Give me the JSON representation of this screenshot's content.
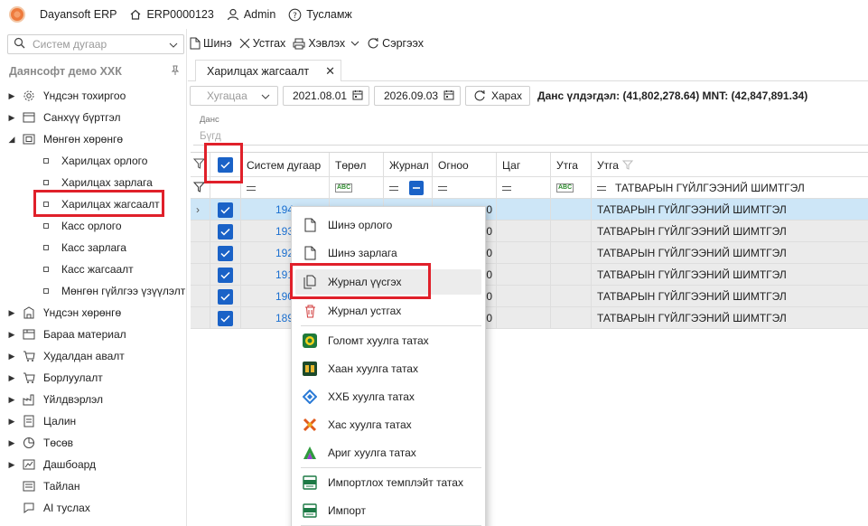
{
  "app": {
    "name": "Dayansoft ERP",
    "doc_code": "ERP0000123",
    "user": "Admin",
    "help": "Тусламж"
  },
  "sidebar": {
    "search_placeholder": "Систем дугаар",
    "company": "Даянсофт демо ХХК",
    "items": [
      {
        "label": "Үндсэн тохиргоо",
        "icon": "gear-icon",
        "expanded": false
      },
      {
        "label": "Санхүү бүртгэл",
        "icon": "ledger-icon",
        "expanded": false
      },
      {
        "label": "Мөнгөн хөрөнгө",
        "icon": "money-icon",
        "expanded": true
      }
    ],
    "subitems": [
      "Харилцах орлого",
      "Харилцах зарлага",
      "Харилцах жагсаалт",
      "Касс орлого",
      "Касс зарлага",
      "Касс жагсаалт",
      "Мөнгөн гүйлгээ үзүүлэлт"
    ],
    "active_subitem": "Харилцах жагсаалт",
    "items_after": [
      {
        "label": "Үндсэн хөрөнгө",
        "icon": "building-icon"
      },
      {
        "label": "Бараа материал",
        "icon": "box-icon"
      },
      {
        "label": "Худалдан авалт",
        "icon": "cart-icon"
      },
      {
        "label": "Борлуулалт",
        "icon": "sale-icon"
      },
      {
        "label": "Үйлдвэрлэл",
        "icon": "factory-icon"
      },
      {
        "label": "Цалин",
        "icon": "salary-icon"
      },
      {
        "label": "Төсөв",
        "icon": "pie-icon"
      },
      {
        "label": "Дашбоард",
        "icon": "dashboard-icon"
      },
      {
        "label": "Тайлан",
        "icon": "report-icon"
      },
      {
        "label": "AI туслах",
        "icon": "ai-icon"
      }
    ]
  },
  "toolbar": {
    "new": "Шинэ",
    "delete": "Устгах",
    "print": "Хэвлэх",
    "refresh": "Сэргээх"
  },
  "tab": {
    "label": "Харилцах жагсаалт"
  },
  "filter": {
    "period_placeholder": "Хугацаа",
    "date_from": "2021.08.01",
    "date_to": "2026.09.03",
    "view_button": "Харах",
    "balance": "Данс үлдэгдэл: (41,802,278.64) MNT: (42,847,891.34)",
    "account_label": "Данс",
    "account_placeholder": "Бүгд"
  },
  "grid": {
    "columns": [
      "Систем дугаар",
      "Төрөл",
      "Журнал",
      "Огноо",
      "Цаг",
      "Утга",
      "Утга"
    ],
    "filter_text": "ТАТВАРЫН ГҮЙЛГЭЭНИЙ ШИМТГЭЛ",
    "rows": [
      {
        "sys": "194",
        "date_tail": "0",
        "desc": "ТАТВАРЫН ГҮЙЛГЭЭНИЙ ШИМТГЭЛ"
      },
      {
        "sys": "193",
        "date_tail": "0",
        "desc": "ТАТВАРЫН ГҮЙЛГЭЭНИЙ ШИМТГЭЛ"
      },
      {
        "sys": "192",
        "date_tail": "0",
        "desc": "ТАТВАРЫН ГҮЙЛГЭЭНИЙ ШИМТГЭЛ"
      },
      {
        "sys": "191",
        "date_tail": "0",
        "desc": "ТАТВАРЫН ГҮЙЛГЭЭНИЙ ШИМТГЭЛ"
      },
      {
        "sys": "190",
        "date_tail": "0",
        "desc": "ТАТВАРЫН ГҮЙЛГЭЭНИЙ ШИМТГЭЛ"
      },
      {
        "sys": "189",
        "date_tail": "0",
        "desc": "ТАТВАРЫН ГҮЙЛГЭЭНИЙ ШИМТГЭЛ"
      }
    ]
  },
  "context_menu": {
    "items": [
      {
        "label": "Шинэ орлого",
        "icon": "document-icon"
      },
      {
        "label": "Шинэ зарлага",
        "icon": "document-icon"
      },
      {
        "label": "Журнал үүсгэх",
        "icon": "copy-document-icon"
      },
      {
        "label": "Журнал устгах",
        "icon": "trash-icon"
      },
      {
        "label": "Голомт хуулга татах",
        "icon": "golomt-bank-icon"
      },
      {
        "label": "Хаан хуулга татах",
        "icon": "khan-bank-icon"
      },
      {
        "label": "ХХБ хуулга татах",
        "icon": "tdb-bank-icon"
      },
      {
        "label": "Хас хуулга татах",
        "icon": "xac-bank-icon"
      },
      {
        "label": "Ариг хуулга татах",
        "icon": "arig-bank-icon"
      },
      {
        "label": "Импортлох темплэйт татах",
        "icon": "excel-icon"
      },
      {
        "label": "Импорт",
        "icon": "excel-icon"
      }
    ]
  }
}
